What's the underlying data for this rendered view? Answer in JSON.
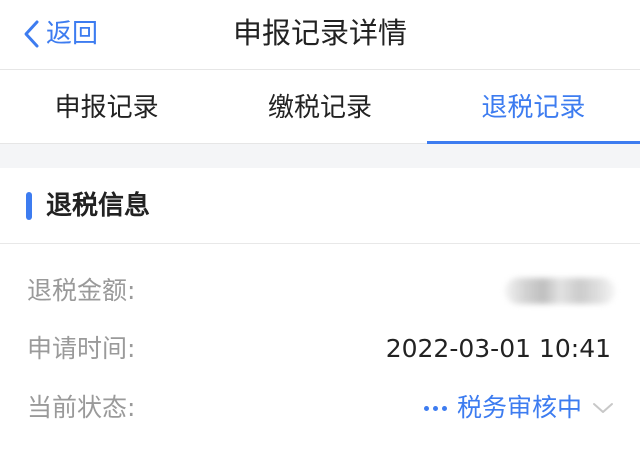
{
  "nav": {
    "back_label": "返回",
    "title": "申报记录详情"
  },
  "tabs": [
    {
      "label": "申报记录",
      "active": false
    },
    {
      "label": "缴税记录",
      "active": false
    },
    {
      "label": "退税记录",
      "active": true
    }
  ],
  "section": {
    "title": "退税信息"
  },
  "details": {
    "amount_label": "退税金额:",
    "amount_value": "",
    "amount_redacted": true,
    "time_label": "申请时间:",
    "time_value": "2022-03-01 10:41",
    "status_label": "当前状态:",
    "status_value": "税务审核中"
  },
  "colors": {
    "accent": "#3d7cf0",
    "label_gray": "#9a9a9a",
    "divider": "#e6e6e6",
    "gap_bg": "#f4f5f7"
  },
  "icons": {
    "back": "chevron-left-icon",
    "status_progress": "ellipsis-icon",
    "status_expand": "chevron-down-icon"
  }
}
